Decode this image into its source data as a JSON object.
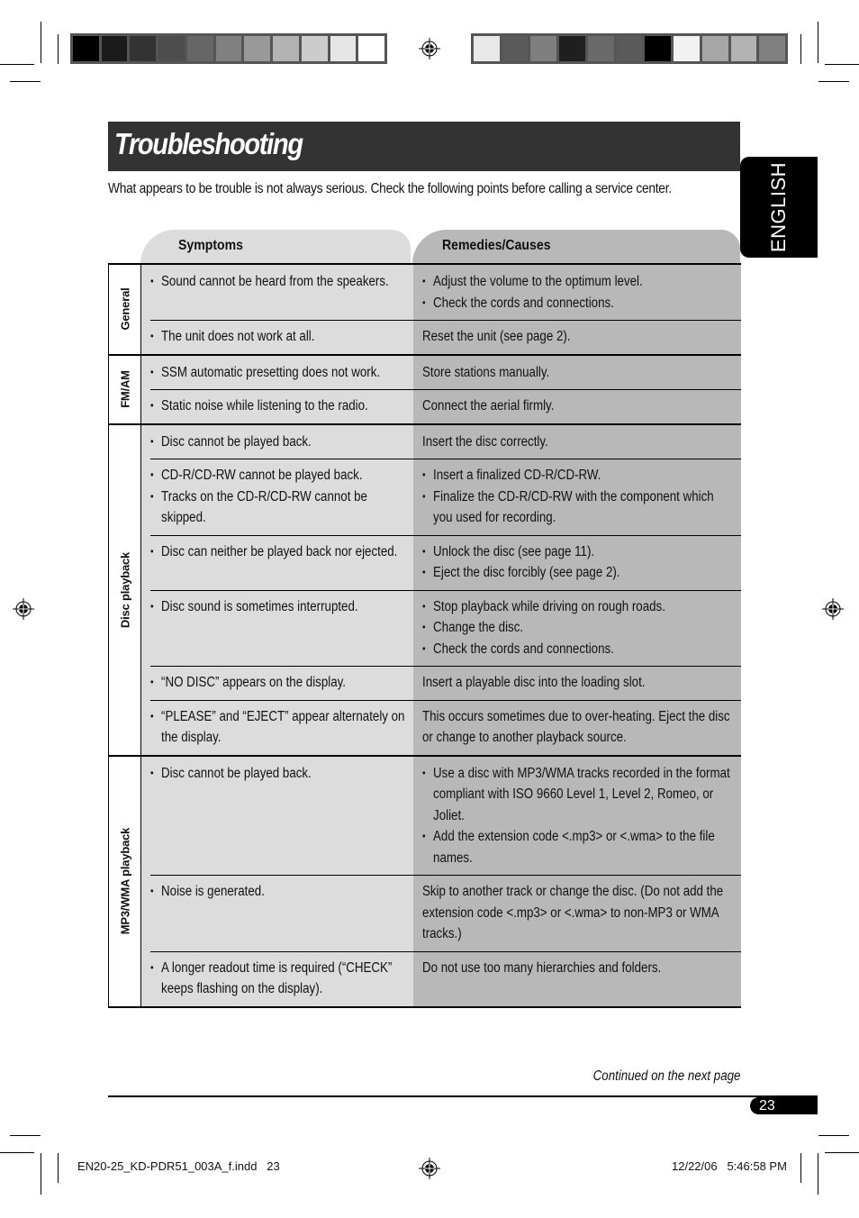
{
  "colorbar_left": [
    "#000000",
    "#1b1b1b",
    "#333333",
    "#4d4d4d",
    "#666666",
    "#808080",
    "#999999",
    "#b3b3b3",
    "#cccccc",
    "#e6e6e6",
    "#ffffff"
  ],
  "colorbar_right": [
    "#e8e8e8",
    "#5a5a5a",
    "#7f7f7f",
    "#1f1f1f",
    "#6a6a6a",
    "#5a5a5a",
    "#000000",
    "#f2f2f2",
    "#a6a6a6",
    "#b3b3b3",
    "#808080"
  ],
  "title": "Troubleshooting",
  "intro": "What appears to be trouble is not always serious. Check the following points before calling a service center.",
  "language_tab": "ENGLISH",
  "table": {
    "headers": {
      "symptoms": "Symptoms",
      "remedies": "Remedies/Causes"
    },
    "groups": [
      {
        "label": "General",
        "rows": [
          {
            "symptoms": [
              "Sound cannot be heard from the speakers."
            ],
            "remedies_list": [
              "Adjust the volume to the optimum level.",
              "Check the cords and connections."
            ]
          },
          {
            "symptoms": [
              "The unit does not work at all."
            ],
            "remedy": "Reset the unit (see page 2)."
          }
        ]
      },
      {
        "label": "FM/AM",
        "rows": [
          {
            "symptoms": [
              "SSM automatic presetting does not work."
            ],
            "remedy": "Store stations manually."
          },
          {
            "symptoms": [
              "Static noise while listening to the radio."
            ],
            "remedy": "Connect the aerial firmly."
          }
        ]
      },
      {
        "label": "Disc playback",
        "rows": [
          {
            "symptoms": [
              "Disc cannot be played back."
            ],
            "remedy": "Insert the disc correctly."
          },
          {
            "symptoms": [
              "CD-R/CD-RW cannot be played back.",
              "Tracks on the CD-R/CD-RW cannot be skipped."
            ],
            "remedies_list": [
              "Insert a finalized CD-R/CD-RW.",
              "Finalize the CD-R/CD-RW with the component which you used for recording."
            ]
          },
          {
            "symptoms": [
              "Disc can neither be played back nor ejected."
            ],
            "remedies_list": [
              "Unlock the disc (see page 11).",
              "Eject the disc forcibly (see page 2)."
            ]
          },
          {
            "symptoms": [
              "Disc sound is sometimes interrupted."
            ],
            "remedies_list": [
              "Stop playback while driving on rough roads.",
              "Change the disc.",
              "Check the cords and connections."
            ]
          },
          {
            "symptoms": [
              "“NO DISC” appears on the display."
            ],
            "remedy": "Insert a playable disc into the loading slot."
          },
          {
            "symptoms": [
              "“PLEASE” and “EJECT” appear alternately on the display."
            ],
            "remedy": "This occurs sometimes due to over-heating. Eject the disc or change to another playback source."
          }
        ]
      },
      {
        "label": "MP3/WMA playback",
        "rows": [
          {
            "symptoms": [
              "Disc cannot be played back."
            ],
            "remedies_list": [
              "Use a disc with MP3/WMA tracks recorded in the format compliant with ISO 9660 Level 1, Level 2, Romeo, or Joliet.",
              "Add the extension code <.mp3> or <.wma> to the file names."
            ]
          },
          {
            "symptoms": [
              "Noise is generated."
            ],
            "remedy": "Skip to another track or change the disc. (Do not add the extension code <.mp3> or <.wma> to non-MP3 or WMA tracks.)"
          },
          {
            "symptoms": [
              "A longer readout time is required (“CHECK” keeps flashing on the display)."
            ],
            "remedy": "Do not use too many hierarchies and folders."
          }
        ]
      }
    ]
  },
  "continued": "Continued on the next page",
  "page_number": "23",
  "footer": {
    "file": "EN20-25_KD-PDR51_003A_f.indd   23",
    "datetime": "12/22/06   5:46:58 PM"
  }
}
